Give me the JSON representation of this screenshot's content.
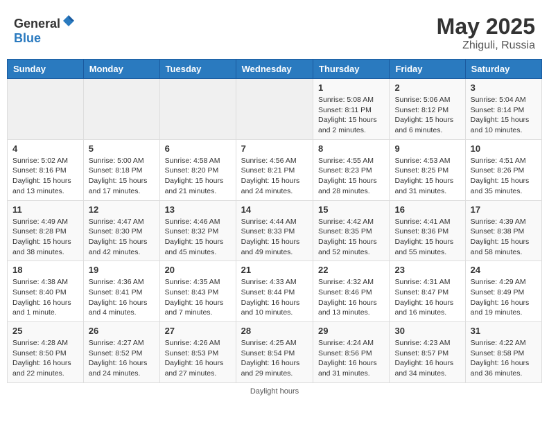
{
  "header": {
    "logo_general": "General",
    "logo_blue": "Blue",
    "month_year": "May 2025",
    "location": "Zhiguli, Russia"
  },
  "footer": {
    "note": "Daylight hours"
  },
  "columns": [
    "Sunday",
    "Monday",
    "Tuesday",
    "Wednesday",
    "Thursday",
    "Friday",
    "Saturday"
  ],
  "weeks": [
    [
      {
        "day": "",
        "info": ""
      },
      {
        "day": "",
        "info": ""
      },
      {
        "day": "",
        "info": ""
      },
      {
        "day": "",
        "info": ""
      },
      {
        "day": "1",
        "info": "Sunrise: 5:08 AM\nSunset: 8:11 PM\nDaylight: 15 hours\nand 2 minutes."
      },
      {
        "day": "2",
        "info": "Sunrise: 5:06 AM\nSunset: 8:12 PM\nDaylight: 15 hours\nand 6 minutes."
      },
      {
        "day": "3",
        "info": "Sunrise: 5:04 AM\nSunset: 8:14 PM\nDaylight: 15 hours\nand 10 minutes."
      }
    ],
    [
      {
        "day": "4",
        "info": "Sunrise: 5:02 AM\nSunset: 8:16 PM\nDaylight: 15 hours\nand 13 minutes."
      },
      {
        "day": "5",
        "info": "Sunrise: 5:00 AM\nSunset: 8:18 PM\nDaylight: 15 hours\nand 17 minutes."
      },
      {
        "day": "6",
        "info": "Sunrise: 4:58 AM\nSunset: 8:20 PM\nDaylight: 15 hours\nand 21 minutes."
      },
      {
        "day": "7",
        "info": "Sunrise: 4:56 AM\nSunset: 8:21 PM\nDaylight: 15 hours\nand 24 minutes."
      },
      {
        "day": "8",
        "info": "Sunrise: 4:55 AM\nSunset: 8:23 PM\nDaylight: 15 hours\nand 28 minutes."
      },
      {
        "day": "9",
        "info": "Sunrise: 4:53 AM\nSunset: 8:25 PM\nDaylight: 15 hours\nand 31 minutes."
      },
      {
        "day": "10",
        "info": "Sunrise: 4:51 AM\nSunset: 8:26 PM\nDaylight: 15 hours\nand 35 minutes."
      }
    ],
    [
      {
        "day": "11",
        "info": "Sunrise: 4:49 AM\nSunset: 8:28 PM\nDaylight: 15 hours\nand 38 minutes."
      },
      {
        "day": "12",
        "info": "Sunrise: 4:47 AM\nSunset: 8:30 PM\nDaylight: 15 hours\nand 42 minutes."
      },
      {
        "day": "13",
        "info": "Sunrise: 4:46 AM\nSunset: 8:32 PM\nDaylight: 15 hours\nand 45 minutes."
      },
      {
        "day": "14",
        "info": "Sunrise: 4:44 AM\nSunset: 8:33 PM\nDaylight: 15 hours\nand 49 minutes."
      },
      {
        "day": "15",
        "info": "Sunrise: 4:42 AM\nSunset: 8:35 PM\nDaylight: 15 hours\nand 52 minutes."
      },
      {
        "day": "16",
        "info": "Sunrise: 4:41 AM\nSunset: 8:36 PM\nDaylight: 15 hours\nand 55 minutes."
      },
      {
        "day": "17",
        "info": "Sunrise: 4:39 AM\nSunset: 8:38 PM\nDaylight: 15 hours\nand 58 minutes."
      }
    ],
    [
      {
        "day": "18",
        "info": "Sunrise: 4:38 AM\nSunset: 8:40 PM\nDaylight: 16 hours\nand 1 minute."
      },
      {
        "day": "19",
        "info": "Sunrise: 4:36 AM\nSunset: 8:41 PM\nDaylight: 16 hours\nand 4 minutes."
      },
      {
        "day": "20",
        "info": "Sunrise: 4:35 AM\nSunset: 8:43 PM\nDaylight: 16 hours\nand 7 minutes."
      },
      {
        "day": "21",
        "info": "Sunrise: 4:33 AM\nSunset: 8:44 PM\nDaylight: 16 hours\nand 10 minutes."
      },
      {
        "day": "22",
        "info": "Sunrise: 4:32 AM\nSunset: 8:46 PM\nDaylight: 16 hours\nand 13 minutes."
      },
      {
        "day": "23",
        "info": "Sunrise: 4:31 AM\nSunset: 8:47 PM\nDaylight: 16 hours\nand 16 minutes."
      },
      {
        "day": "24",
        "info": "Sunrise: 4:29 AM\nSunset: 8:49 PM\nDaylight: 16 hours\nand 19 minutes."
      }
    ],
    [
      {
        "day": "25",
        "info": "Sunrise: 4:28 AM\nSunset: 8:50 PM\nDaylight: 16 hours\nand 22 minutes."
      },
      {
        "day": "26",
        "info": "Sunrise: 4:27 AM\nSunset: 8:52 PM\nDaylight: 16 hours\nand 24 minutes."
      },
      {
        "day": "27",
        "info": "Sunrise: 4:26 AM\nSunset: 8:53 PM\nDaylight: 16 hours\nand 27 minutes."
      },
      {
        "day": "28",
        "info": "Sunrise: 4:25 AM\nSunset: 8:54 PM\nDaylight: 16 hours\nand 29 minutes."
      },
      {
        "day": "29",
        "info": "Sunrise: 4:24 AM\nSunset: 8:56 PM\nDaylight: 16 hours\nand 31 minutes."
      },
      {
        "day": "30",
        "info": "Sunrise: 4:23 AM\nSunset: 8:57 PM\nDaylight: 16 hours\nand 34 minutes."
      },
      {
        "day": "31",
        "info": "Sunrise: 4:22 AM\nSunset: 8:58 PM\nDaylight: 16 hours\nand 36 minutes."
      }
    ]
  ]
}
